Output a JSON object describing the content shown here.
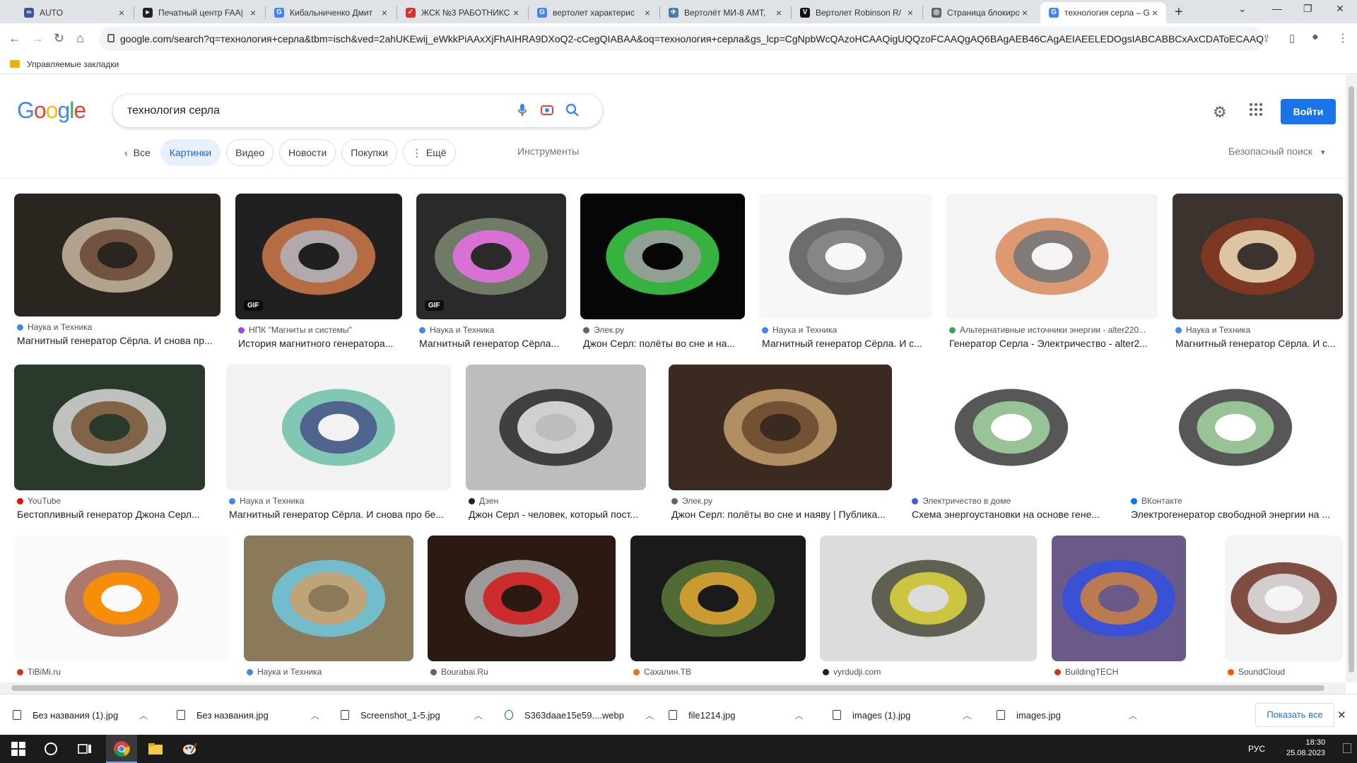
{
  "browser": {
    "tabs": [
      {
        "title": "AUTO",
        "fav_color": "#3b5998"
      },
      {
        "title": "Печатный центр FAA|",
        "fav_color": "#222"
      },
      {
        "title": "Кибальниченко Дмит",
        "fav_color": "#4285f4"
      },
      {
        "title": "ЖСК №3 РАБОТНИКС",
        "fav_color": "#d93025"
      },
      {
        "title": "вертолет характерис",
        "fav_color": "#4285f4"
      },
      {
        "title": "Вертолёт МИ-8 АМТ,",
        "fav_color": "#4a7aa8"
      },
      {
        "title": "Вертолет Robinson R/",
        "fav_color": "#111"
      },
      {
        "title": "Страница блокировк",
        "fav_color": "#5f6368"
      },
      {
        "title": "технология серла – G",
        "fav_color": "#4285f4"
      }
    ],
    "new_tab_label": "+",
    "url": "google.com/search?q=технология+серла&tbm=isch&ved=2ahUKEwij_eWkkPiAAxXjFhAIHRA9DXoQ2-cCegQIABAA&oq=технология+серла&gs_lcp=CgNpbWcQAzoHCAAQigUQQzoFCAAQgAQ6BAgAEB46CAgAEIAEELEDOgsIABCABBCxAxCDAToECAAQzo...",
    "bookmarks_label": "Управляемые закладки"
  },
  "google": {
    "logo": "Google",
    "query": "технология серла",
    "signin_label": "Войти",
    "filters": [
      "Все",
      "Картинки",
      "Видео",
      "Новости",
      "Покупки",
      "Ещё"
    ],
    "tools_label": "Инструменты",
    "safe_search_label": "Безопасный поиск"
  },
  "results": [
    {
      "source": "Наука и Техника",
      "title": "Магнитный генератор Сёрла. И снова пр...",
      "fav": "#4285f4",
      "gif": false
    },
    {
      "source": "НПК \"Магниты и системы\"",
      "title": "История магнитного генератора...",
      "fav": "#a142f4",
      "gif": true
    },
    {
      "source": "Наука и Техника",
      "title": "Магнитный генератор Сёрла...",
      "fav": "#4285f4",
      "gif": true
    },
    {
      "source": "Элек.ру",
      "title": "Джон Серл: полёты во сне и на...",
      "fav": "#5f6368",
      "gif": false
    },
    {
      "source": "Наука и Техника",
      "title": "Магнитный генератор Сёрла. И с...",
      "fav": "#4285f4",
      "gif": false
    },
    {
      "source": "Альтернативные источники энергии - alter220...",
      "title": "Генератор Серла - Электричество - alter2...",
      "fav": "#34a853",
      "gif": false
    },
    {
      "source": "Наука и Техника",
      "title": "Магнитный генератор Сёрла. И с...",
      "fav": "#4285f4",
      "gif": false
    },
    {
      "source": "YouTube",
      "title": "Бестопливный генератор Джона Серл...",
      "fav": "#ff0000",
      "gif": false
    },
    {
      "source": "Наука и Техника",
      "title": "Магнитный генератор Сёрла. И снова про бе...",
      "fav": "#4285f4",
      "gif": false
    },
    {
      "source": "Дзен",
      "title": "Джон Серл - человек, который пост...",
      "fav": "#202124",
      "gif": false
    },
    {
      "source": "Элек.ру",
      "title": "Джон Серл: полёты во сне и наяву | Публика...",
      "fav": "#5f6368",
      "gif": false
    },
    {
      "source": "Электричество в доме",
      "title": "Схема энергоустановки на основе гене...",
      "fav": "#3b5bdb",
      "gif": false
    },
    {
      "source": "ВКонтакте",
      "title": "Электрогенератор свободной энергии на ...",
      "fav": "#0077ff",
      "gif": false
    },
    {
      "source": "TiBiMi.ru",
      "title": "",
      "fav": "#d93025",
      "gif": false
    },
    {
      "source": "Наука и Техника",
      "title": "",
      "fav": "#4285f4",
      "gif": false
    },
    {
      "source": "Bourabai.Ru",
      "title": "",
      "fav": "#5f6368",
      "gif": false
    },
    {
      "source": "Сахалин.ТВ",
      "title": "",
      "fav": "#e8710a",
      "gif": false
    },
    {
      "source": "vyrdudji.com",
      "title": "",
      "fav": "#202124",
      "gif": false
    },
    {
      "source": "BuildingTECH",
      "title": "",
      "fav": "#d93025",
      "gif": false
    },
    {
      "source": "SoundCloud",
      "title": "",
      "fav": "#ff5500",
      "gif": false
    }
  ],
  "gif_badge": "GIF",
  "downloads": {
    "items": [
      "Без названия (1).jpg",
      "Без названия.jpg",
      "Screenshot_1-5.jpg",
      "S363daae15e59....webp",
      "file1214.jpg",
      "images (1).jpg",
      "images.jpg"
    ],
    "show_all_label": "Показать все"
  },
  "taskbar": {
    "lang": "РУС",
    "time": "18:30",
    "date": "25.08.2023"
  }
}
